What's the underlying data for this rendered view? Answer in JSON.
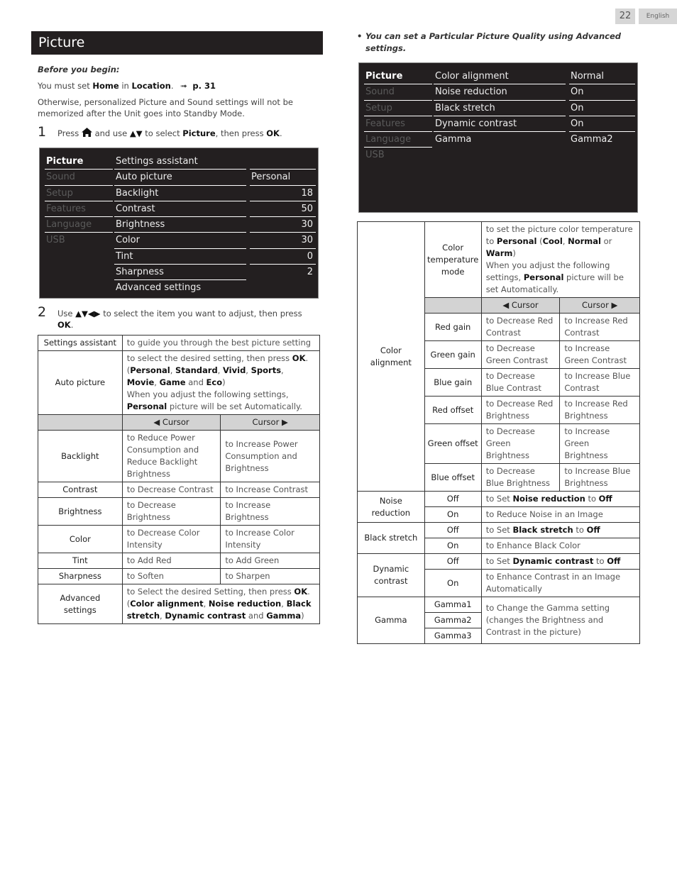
{
  "page": {
    "number": "22",
    "language": "English"
  },
  "section_title": "Picture",
  "before": {
    "heading": "Before you begin:",
    "must_set_prefix": "You must set ",
    "must_set_home": "Home",
    "must_set_in": " in ",
    "must_set_location": "Location",
    "must_set_period": ".",
    "arrow_ref": "➟",
    "page_ref": "p. 31",
    "otherwise": "Otherwise, personalized Picture and Sound settings will not be memorized after the Unit goes into Standby Mode."
  },
  "step1": {
    "num": "1",
    "press": "Press",
    "home_icon": "home-icon",
    "and_use": "and use",
    "arrows": "▲▼",
    "to_select": "to select",
    "picture": "Picture",
    "then_press": ", then press",
    "ok": "OK",
    "end": "."
  },
  "step2": {
    "num": "2",
    "use": "Use",
    "arrows": "▲▼◀▶",
    "rest": "to select the item you want to adjust, then press",
    "ok": "OK",
    "end": "."
  },
  "menu1": {
    "categories": [
      "Picture",
      "Sound",
      "Setup",
      "Features",
      "Language",
      "USB"
    ],
    "items": [
      "Settings assistant",
      "Auto picture",
      "Backlight",
      "Contrast",
      "Brightness",
      "Color",
      "Tint",
      "Sharpness",
      "Advanced settings"
    ],
    "values": [
      "",
      "Personal",
      "18",
      "50",
      "30",
      "30",
      "0",
      "2",
      ""
    ]
  },
  "menu2": {
    "categories": [
      "Picture",
      "Sound",
      "Setup",
      "Features",
      "Language",
      "USB"
    ],
    "items": [
      "Color alignment",
      "Noise reduction",
      "Black stretch",
      "Dynamic contrast",
      "Gamma"
    ],
    "values": [
      "Normal",
      "On",
      "On",
      "On",
      "Gamma2"
    ]
  },
  "note": {
    "bullet": "•",
    "text": "You can set a Particular Picture Quality using Advanced settings."
  },
  "table1": {
    "settings_assistant": {
      "label": "Settings assistant",
      "desc": "to guide you through the best picture setting"
    },
    "auto_picture": {
      "label": "Auto picture",
      "line1": "to select the desired setting, then press ",
      "ok": "OK",
      "open": "(",
      "modes": [
        "Personal",
        "Standard",
        "Vivid",
        "Sports",
        "Movie",
        "Game"
      ],
      "and": " and ",
      "eco": "Eco",
      "close": ")",
      "line3a": "When you adjust the following settings, ",
      "personal": "Personal",
      "line3b": " picture will be set Automatically."
    },
    "header": {
      "left": "◀ Cursor",
      "right": "Cursor ▶"
    },
    "rows": [
      {
        "label": "Backlight",
        "left": "to Reduce Power Consumption and Reduce Backlight Brightness",
        "right": "to Increase Power Consumption and Brightness"
      },
      {
        "label": "Contrast",
        "left": "to Decrease Contrast",
        "right": "to Increase Contrast"
      },
      {
        "label": "Brightness",
        "left": "to Decrease Brightness",
        "right": "to Increase Brightness"
      },
      {
        "label": "Color",
        "left": "to Decrease Color Intensity",
        "right": "to Increase Color Intensity"
      },
      {
        "label": "Tint",
        "left": "to Add Red",
        "right": "to Add Green"
      },
      {
        "label": "Sharpness",
        "left": "to Soften",
        "right": "to Sharpen"
      }
    ],
    "advanced": {
      "label": "Advanced settings",
      "line1": "to Select the desired Setting, then press ",
      "ok": "OK",
      "items_open": "(",
      "items": [
        "Color alignment",
        "Noise reduction",
        "Black stretch",
        "Dynamic contrast"
      ],
      "and": " and ",
      "gamma": "Gamma",
      "close": ")"
    }
  },
  "table2": {
    "color_alignment_label": "Color alignment",
    "temp_mode": {
      "label": "Color temperature mode",
      "line1": "to set the picture color temperature to ",
      "personal": "Personal",
      "open": " (",
      "cool": "Cool",
      "comma": ", ",
      "normal": "Normal",
      "or": " or ",
      "warm": "Warm",
      "close": ")",
      "line2a": "When you adjust the following settings, ",
      "personal2": "Personal",
      "line2b": " picture will be set Automatically."
    },
    "header": {
      "left": "◀ Cursor",
      "right": "Cursor ▶"
    },
    "rows": [
      {
        "label": "Red gain",
        "left": "to Decrease Red Contrast",
        "right": "to Increase Red Contrast"
      },
      {
        "label": "Green gain",
        "left": "to Decrease Green Contrast",
        "right": "to Increase Green Contrast"
      },
      {
        "label": "Blue gain",
        "left": "to Decrease Blue Contrast",
        "right": "to Increase Blue Contrast"
      },
      {
        "label": "Red offset",
        "left": "to Decrease Red Brightness",
        "right": "to Increase Red Brightness"
      },
      {
        "label": "Green offset",
        "left": "to Decrease Green Brightness",
        "right": "to Increase Green Brightness"
      },
      {
        "label": "Blue offset",
        "left": "to Decrease Blue Brightness",
        "right": "to Increase Blue Brightness"
      }
    ],
    "noise": {
      "label": "Noise reduction",
      "off": "Off",
      "off_a": "to Set ",
      "off_b": "Noise reduction",
      "off_c": " to ",
      "off_d": "Off",
      "on": "On",
      "on_desc": "to Reduce Noise in an Image"
    },
    "black": {
      "label": "Black stretch",
      "off": "Off",
      "off_a": "to Set ",
      "off_b": "Black stretch",
      "off_c": " to ",
      "off_d": "Off",
      "on": "On",
      "on_desc": "to Enhance Black Color"
    },
    "dynamic": {
      "label": "Dynamic contrast",
      "off": "Off",
      "off_a": "to Set ",
      "off_b": "Dynamic contrast",
      "off_c": " to ",
      "off_d": "Off",
      "on": "On",
      "on_desc": "to Enhance Contrast in an Image Automatically"
    },
    "gamma": {
      "label": "Gamma",
      "options": [
        "Gamma1",
        "Gamma2",
        "Gamma3"
      ],
      "desc": "to Change the Gamma setting (changes the Brightness and Contrast in the picture)"
    }
  }
}
